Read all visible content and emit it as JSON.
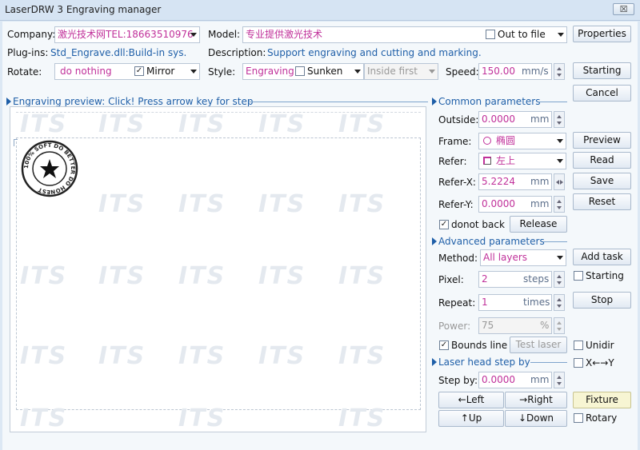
{
  "window": {
    "title": "LaserDRW 3 Engraving manager",
    "close_glyph": "☒"
  },
  "top": {
    "company_label": "Company:",
    "company_value": "激光技术网TEL:18663510976",
    "plugins_label": "Plug-ins:",
    "plugins_value": "Std_Engrave.dll:Build-in sys.",
    "rotate_label": "Rotate:",
    "rotate_value": "do nothing",
    "mirror_label": "Mirror",
    "model_label": "Model:",
    "model_value": "专业提供激光技术",
    "out_to_file_label": "Out to file",
    "description_label": "Description:",
    "description_value": "Support engraving and cutting and marking.",
    "style_label": "Style:",
    "style_value": "Engraving",
    "sunken_label": "Sunken",
    "inside_first_value": "Inside first",
    "speed_label": "Speed:",
    "speed_value": "150.00",
    "speed_unit": "mm/s"
  },
  "right_buttons": {
    "properties": "Properties",
    "starting": "Starting",
    "cancel": "Cancel",
    "preview": "Preview",
    "read": "Read",
    "save": "Save",
    "reset": "Reset",
    "add_task": "Add task",
    "stop": "Stop",
    "fixture": "Fixture"
  },
  "preview_section": {
    "title": "Engraving preview: Click! Press arrow key for step",
    "watermark": "ITS",
    "stamp_text": "100% SOFT  DO  BETTER  DO  HONEST"
  },
  "common": {
    "title": "Common parameters",
    "outside_label": "Outside:",
    "outside_value": "0.0000",
    "outside_unit": "mm",
    "frame_label": "Frame:",
    "frame_value": "椭圆",
    "refer_label": "Refer:",
    "refer_value": "左上",
    "refer_x_label": "Refer-X:",
    "refer_x_value": "5.2224",
    "refer_x_unit": "mm",
    "refer_y_label": "Refer-Y:",
    "refer_y_value": "0.0000",
    "refer_y_unit": "mm",
    "donot_back_label": "donot back",
    "release_button": "Release"
  },
  "advanced": {
    "title": "Advanced parameters",
    "method_label": "Method:",
    "method_value": "All layers",
    "pixel_label": "Pixel:",
    "pixel_value": "2",
    "pixel_unit": "steps",
    "repeat_label": "Repeat:",
    "repeat_value": "1",
    "repeat_unit": "times",
    "power_label": "Power:",
    "power_value": "75",
    "power_unit": "%",
    "bounds_line_label": "Bounds line",
    "test_laser_button": "Test laser",
    "starting_check_label": "Starting",
    "unidir_label": "Unidir"
  },
  "laser_step": {
    "title": "Laser head step by",
    "step_label": "Step by:",
    "step_value": "0.0000",
    "step_unit": "mm",
    "left": "←Left",
    "right": "→Right",
    "up": "↑Up",
    "down": "↓Down",
    "xy_label": "X←→Y",
    "rotary_label": "Rotary"
  },
  "checks": {
    "mirror": true,
    "out_to_file": false,
    "sunken": false,
    "donot_back": true,
    "bounds_line": true,
    "starting": false,
    "unidir": false,
    "xy": false,
    "rotary": false
  },
  "colors": {
    "value_text": "#c0309a",
    "info_text": "#1f5fa8",
    "window_bg": "#dce8f4"
  },
  "icons": [
    "dropdown-arrow-icon",
    "ellipse-frame-icon",
    "refer-corner-icon",
    "spin-arrows-icon",
    "star-icon",
    "close-icon"
  ]
}
